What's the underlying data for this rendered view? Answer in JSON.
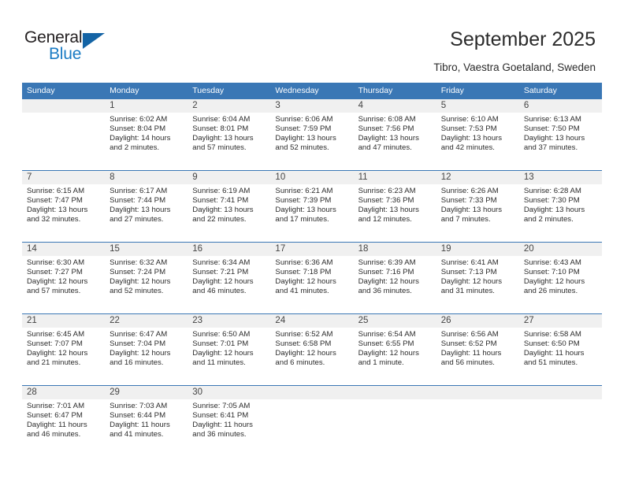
{
  "brand": {
    "name_top": "General",
    "name_bottom": "Blue",
    "triangle_color": "#1464a5",
    "blue_color": "#1a7bc4"
  },
  "header": {
    "title": "September 2025",
    "subtitle": "Tibro, Vaestra Goetaland, Sweden"
  },
  "theme": {
    "header_blue": "#3a77b5",
    "band_gray": "#f0f0f0",
    "text": "#2c2c2c"
  },
  "calendar": {
    "weekdays": [
      "Sunday",
      "Monday",
      "Tuesday",
      "Wednesday",
      "Thursday",
      "Friday",
      "Saturday"
    ],
    "weeks": [
      [
        {
          "day": "",
          "sunrise": "",
          "sunset": "",
          "daylight": "",
          "daylight2": ""
        },
        {
          "day": "1",
          "sunrise": "Sunrise: 6:02 AM",
          "sunset": "Sunset: 8:04 PM",
          "daylight": "Daylight: 14 hours",
          "daylight2": "and 2 minutes."
        },
        {
          "day": "2",
          "sunrise": "Sunrise: 6:04 AM",
          "sunset": "Sunset: 8:01 PM",
          "daylight": "Daylight: 13 hours",
          "daylight2": "and 57 minutes."
        },
        {
          "day": "3",
          "sunrise": "Sunrise: 6:06 AM",
          "sunset": "Sunset: 7:59 PM",
          "daylight": "Daylight: 13 hours",
          "daylight2": "and 52 minutes."
        },
        {
          "day": "4",
          "sunrise": "Sunrise: 6:08 AM",
          "sunset": "Sunset: 7:56 PM",
          "daylight": "Daylight: 13 hours",
          "daylight2": "and 47 minutes."
        },
        {
          "day": "5",
          "sunrise": "Sunrise: 6:10 AM",
          "sunset": "Sunset: 7:53 PM",
          "daylight": "Daylight: 13 hours",
          "daylight2": "and 42 minutes."
        },
        {
          "day": "6",
          "sunrise": "Sunrise: 6:13 AM",
          "sunset": "Sunset: 7:50 PM",
          "daylight": "Daylight: 13 hours",
          "daylight2": "and 37 minutes."
        }
      ],
      [
        {
          "day": "7",
          "sunrise": "Sunrise: 6:15 AM",
          "sunset": "Sunset: 7:47 PM",
          "daylight": "Daylight: 13 hours",
          "daylight2": "and 32 minutes."
        },
        {
          "day": "8",
          "sunrise": "Sunrise: 6:17 AM",
          "sunset": "Sunset: 7:44 PM",
          "daylight": "Daylight: 13 hours",
          "daylight2": "and 27 minutes."
        },
        {
          "day": "9",
          "sunrise": "Sunrise: 6:19 AM",
          "sunset": "Sunset: 7:41 PM",
          "daylight": "Daylight: 13 hours",
          "daylight2": "and 22 minutes."
        },
        {
          "day": "10",
          "sunrise": "Sunrise: 6:21 AM",
          "sunset": "Sunset: 7:39 PM",
          "daylight": "Daylight: 13 hours",
          "daylight2": "and 17 minutes."
        },
        {
          "day": "11",
          "sunrise": "Sunrise: 6:23 AM",
          "sunset": "Sunset: 7:36 PM",
          "daylight": "Daylight: 13 hours",
          "daylight2": "and 12 minutes."
        },
        {
          "day": "12",
          "sunrise": "Sunrise: 6:26 AM",
          "sunset": "Sunset: 7:33 PM",
          "daylight": "Daylight: 13 hours",
          "daylight2": "and 7 minutes."
        },
        {
          "day": "13",
          "sunrise": "Sunrise: 6:28 AM",
          "sunset": "Sunset: 7:30 PM",
          "daylight": "Daylight: 13 hours",
          "daylight2": "and 2 minutes."
        }
      ],
      [
        {
          "day": "14",
          "sunrise": "Sunrise: 6:30 AM",
          "sunset": "Sunset: 7:27 PM",
          "daylight": "Daylight: 12 hours",
          "daylight2": "and 57 minutes."
        },
        {
          "day": "15",
          "sunrise": "Sunrise: 6:32 AM",
          "sunset": "Sunset: 7:24 PM",
          "daylight": "Daylight: 12 hours",
          "daylight2": "and 52 minutes."
        },
        {
          "day": "16",
          "sunrise": "Sunrise: 6:34 AM",
          "sunset": "Sunset: 7:21 PM",
          "daylight": "Daylight: 12 hours",
          "daylight2": "and 46 minutes."
        },
        {
          "day": "17",
          "sunrise": "Sunrise: 6:36 AM",
          "sunset": "Sunset: 7:18 PM",
          "daylight": "Daylight: 12 hours",
          "daylight2": "and 41 minutes."
        },
        {
          "day": "18",
          "sunrise": "Sunrise: 6:39 AM",
          "sunset": "Sunset: 7:16 PM",
          "daylight": "Daylight: 12 hours",
          "daylight2": "and 36 minutes."
        },
        {
          "day": "19",
          "sunrise": "Sunrise: 6:41 AM",
          "sunset": "Sunset: 7:13 PM",
          "daylight": "Daylight: 12 hours",
          "daylight2": "and 31 minutes."
        },
        {
          "day": "20",
          "sunrise": "Sunrise: 6:43 AM",
          "sunset": "Sunset: 7:10 PM",
          "daylight": "Daylight: 12 hours",
          "daylight2": "and 26 minutes."
        }
      ],
      [
        {
          "day": "21",
          "sunrise": "Sunrise: 6:45 AM",
          "sunset": "Sunset: 7:07 PM",
          "daylight": "Daylight: 12 hours",
          "daylight2": "and 21 minutes."
        },
        {
          "day": "22",
          "sunrise": "Sunrise: 6:47 AM",
          "sunset": "Sunset: 7:04 PM",
          "daylight": "Daylight: 12 hours",
          "daylight2": "and 16 minutes."
        },
        {
          "day": "23",
          "sunrise": "Sunrise: 6:50 AM",
          "sunset": "Sunset: 7:01 PM",
          "daylight": "Daylight: 12 hours",
          "daylight2": "and 11 minutes."
        },
        {
          "day": "24",
          "sunrise": "Sunrise: 6:52 AM",
          "sunset": "Sunset: 6:58 PM",
          "daylight": "Daylight: 12 hours",
          "daylight2": "and 6 minutes."
        },
        {
          "day": "25",
          "sunrise": "Sunrise: 6:54 AM",
          "sunset": "Sunset: 6:55 PM",
          "daylight": "Daylight: 12 hours",
          "daylight2": "and 1 minute."
        },
        {
          "day": "26",
          "sunrise": "Sunrise: 6:56 AM",
          "sunset": "Sunset: 6:52 PM",
          "daylight": "Daylight: 11 hours",
          "daylight2": "and 56 minutes."
        },
        {
          "day": "27",
          "sunrise": "Sunrise: 6:58 AM",
          "sunset": "Sunset: 6:50 PM",
          "daylight": "Daylight: 11 hours",
          "daylight2": "and 51 minutes."
        }
      ],
      [
        {
          "day": "28",
          "sunrise": "Sunrise: 7:01 AM",
          "sunset": "Sunset: 6:47 PM",
          "daylight": "Daylight: 11 hours",
          "daylight2": "and 46 minutes."
        },
        {
          "day": "29",
          "sunrise": "Sunrise: 7:03 AM",
          "sunset": "Sunset: 6:44 PM",
          "daylight": "Daylight: 11 hours",
          "daylight2": "and 41 minutes."
        },
        {
          "day": "30",
          "sunrise": "Sunrise: 7:05 AM",
          "sunset": "Sunset: 6:41 PM",
          "daylight": "Daylight: 11 hours",
          "daylight2": "and 36 minutes."
        },
        {
          "day": "",
          "sunrise": "",
          "sunset": "",
          "daylight": "",
          "daylight2": ""
        },
        {
          "day": "",
          "sunrise": "",
          "sunset": "",
          "daylight": "",
          "daylight2": ""
        },
        {
          "day": "",
          "sunrise": "",
          "sunset": "",
          "daylight": "",
          "daylight2": ""
        },
        {
          "day": "",
          "sunrise": "",
          "sunset": "",
          "daylight": "",
          "daylight2": ""
        }
      ]
    ]
  }
}
